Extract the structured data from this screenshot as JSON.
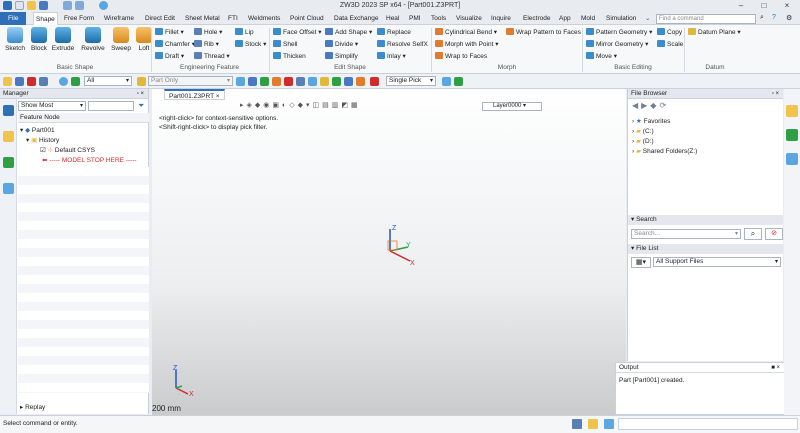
{
  "window": {
    "title": "ZW3D 2023 SP x64 - [Part001.Z3PRT]"
  },
  "menu": {
    "file": "File",
    "tabs": [
      "Shape",
      "Free Form",
      "Wireframe",
      "Direct Edit",
      "Sheet Metal",
      "FTI",
      "Weldments",
      "Point Cloud",
      "Data Exchange",
      "Heal",
      "PMI",
      "Tools",
      "Visualize",
      "Inquire",
      "Electrode",
      "App",
      "Mold",
      "Simulation"
    ],
    "search_placeholder": "Find a command"
  },
  "ribbon": {
    "basic_shape": {
      "label": "Basic Shape",
      "buttons": [
        "Sketch",
        "Block",
        "Extrude",
        "Revolve",
        "Sweep",
        "Loft"
      ]
    },
    "engineering_feature": {
      "label": "Engineering Feature",
      "col1": [
        "Fillet",
        "Chamfer",
        "Draft"
      ],
      "col2": [
        "Hole",
        "Rib",
        "Thread"
      ],
      "col3": [
        "Lip",
        "Stock"
      ]
    },
    "edit_shape": {
      "label": "Edit Shape",
      "col1": [
        "Face Offset",
        "Shell",
        "Thicken"
      ],
      "col2": [
        "Add Shape",
        "Divide",
        "Simplify"
      ],
      "col3": [
        "Replace",
        "Resolve SelfX",
        "Inlay"
      ]
    },
    "morph": {
      "label": "Morph",
      "col1": [
        "Cylindrical Bend",
        "Morph with Point",
        "Wrap to Faces"
      ],
      "col2": [
        "Wrap Pattern to Faces"
      ]
    },
    "basic_editing": {
      "label": "Basic Editing",
      "col1": [
        "Pattern Geometry",
        "Mirror Geometry",
        "Move"
      ],
      "col2": [
        "Copy",
        "Scale"
      ]
    },
    "datum": {
      "label": "Datum",
      "col1": [
        "Datum Plane"
      ]
    }
  },
  "toolbar": {
    "filter": "All",
    "part_only": "Part Only",
    "pick": "Single Pick"
  },
  "manager": {
    "title": "Manager",
    "show": "Show Most",
    "column": "Feature Node",
    "tree": {
      "part": "Part001",
      "history": "History",
      "csys": "Default CSYS",
      "stop": "----- MODEL STOP HERE -----"
    },
    "replay": "Replay"
  },
  "viewport": {
    "tab": "Part001.Z3PRT",
    "hint1": "<right-click> for context-sensitive options.",
    "hint2": "<Shift-right-click> to display pick filter.",
    "layer": "Layer0000",
    "scale": "200 mm",
    "axes": {
      "x": "X",
      "y": "Y",
      "z": "Z"
    }
  },
  "file_browser": {
    "title": "File Browser",
    "items": [
      "Favorites",
      "(C:)",
      "(D:)",
      "Shared Folders(Z:)"
    ],
    "search_title": "Search",
    "search_placeholder": "Search...",
    "file_list_title": "File List",
    "file_filter": "All Support Files"
  },
  "output": {
    "title": "Output",
    "message": "Part [Part001] created."
  },
  "status": {
    "text": "Select command or entity."
  },
  "colors": {
    "accent": "#2f6fb7",
    "axis_x": "#d12b2b",
    "axis_y": "#2ea043",
    "axis_z": "#2553c2"
  }
}
